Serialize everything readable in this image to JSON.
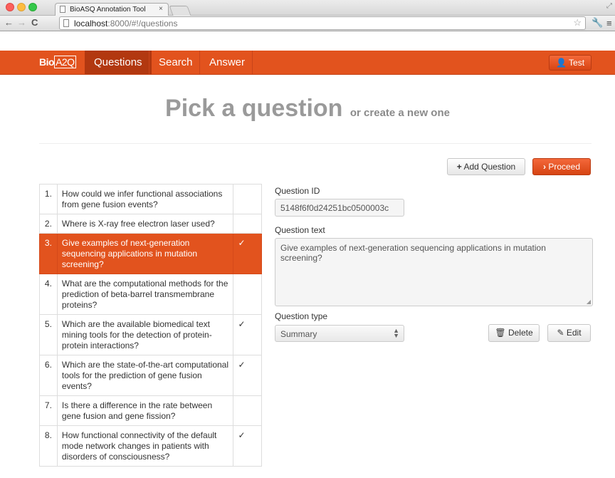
{
  "browser": {
    "tab_title": "BioASQ Annotation Tool",
    "tab_close": "×",
    "url_host": "localhost",
    "url_rest": ":8000/#!/questions"
  },
  "navbar": {
    "brand_prefix": "Bio",
    "brand_box": "A2Q",
    "items": [
      {
        "label": "Questions",
        "active": true
      },
      {
        "label": "Search",
        "active": false
      },
      {
        "label": "Answer",
        "active": false
      }
    ],
    "user_label": "Test"
  },
  "heading": {
    "title": "Pick a question",
    "subtitle": "or create a new one"
  },
  "actions": {
    "add_question": "Add Question",
    "proceed": "Proceed"
  },
  "questions": [
    {
      "num": "1.",
      "text": "How could we infer functional associations from gene fusion events?",
      "check": ""
    },
    {
      "num": "2.",
      "text": "Where is X-ray free electron laser used?",
      "check": ""
    },
    {
      "num": "3.",
      "text": "Give examples of next-generation sequencing applications in mutation screening?",
      "check": "✓",
      "selected": true
    },
    {
      "num": "4.",
      "text": "What are the computational methods for the prediction of beta-barrel transmembrane proteins?",
      "check": ""
    },
    {
      "num": "5.",
      "text": "Which are the available biomedical text mining tools for the detection of protein-protein interactions?",
      "check": "✓"
    },
    {
      "num": "6.",
      "text": "Which are the state-of-the-art computational tools for the prediction of gene fusion events?",
      "check": "✓"
    },
    {
      "num": "7.",
      "text": "Is there a difference in the rate between gene fusion and gene fission?",
      "check": ""
    },
    {
      "num": "8.",
      "text": "How functional connectivity of the default mode network changes in patients with disorders of consciousness?",
      "check": "✓"
    }
  ],
  "form": {
    "id_label": "Question ID",
    "id_value": "5148f6f0d24251bc0500003c",
    "text_label": "Question text",
    "text_value": "Give examples of next-generation sequencing applications in mutation screening?",
    "type_label": "Question type",
    "type_value": "Summary",
    "delete_label": "Delete",
    "edit_label": "Edit"
  },
  "colors": {
    "accent": "#e2531e",
    "accent_dark": "#b23810"
  }
}
